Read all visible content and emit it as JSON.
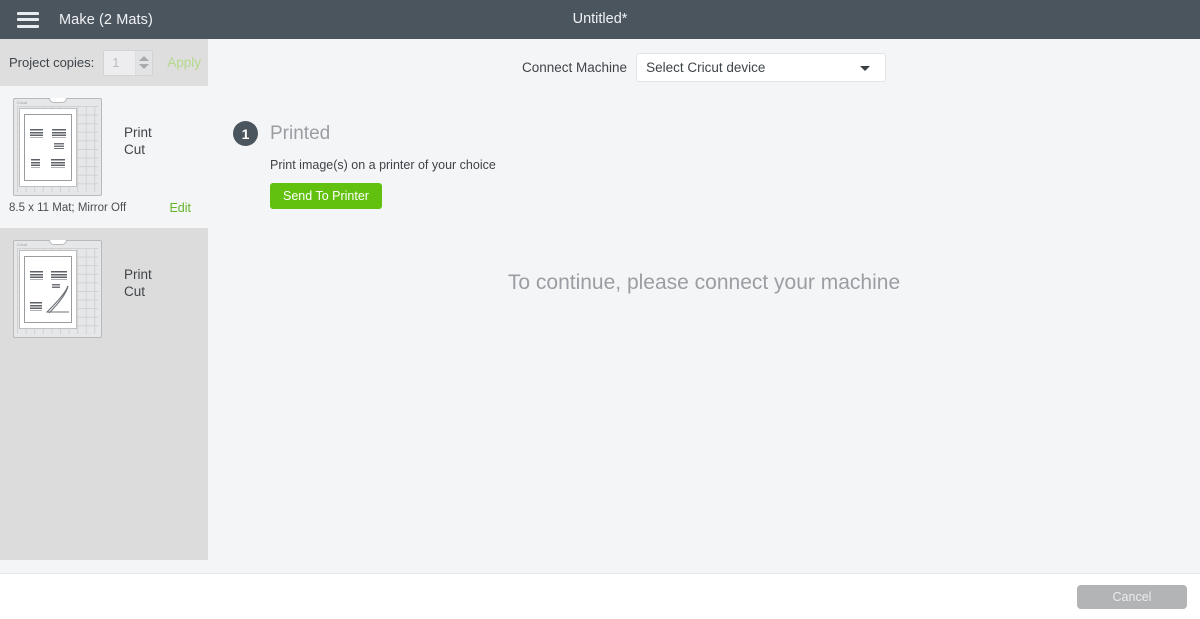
{
  "header": {
    "menu_icon": "hamburger-icon",
    "make_title": "Make (2 Mats)",
    "document_title": "Untitled*"
  },
  "sidebar": {
    "copies": {
      "label": "Project copies:",
      "value": "1",
      "apply_label": "Apply"
    },
    "mats": [
      {
        "selected": true,
        "actions": [
          "Print",
          "Cut"
        ],
        "caption": "8.5 x 11 Mat; Mirror Off",
        "edit_label": "Edit",
        "mat_brand": "Cricut"
      },
      {
        "selected": false,
        "actions": [
          "Print",
          "Cut"
        ],
        "caption": "",
        "edit_label": "",
        "mat_brand": "Cricut"
      }
    ]
  },
  "main": {
    "connect": {
      "label": "Connect Machine",
      "select_value": "Select Cricut device",
      "caret_icon": "chevron-down-icon"
    },
    "step": {
      "number": "1",
      "title": "Printed",
      "description": "Print image(s) on a printer of your choice",
      "button_label": "Send To Printer"
    },
    "connect_message": "To continue, please connect your machine"
  },
  "footer": {
    "cancel_label": "Cancel"
  },
  "colors": {
    "header_bg": "#4b555e",
    "accent_green": "#62c10e",
    "link_green": "#62b426",
    "panel_bg": "#f4f5f7",
    "panel_alt_bg": "#dcdcdc",
    "muted_text": "#9a9ea2"
  }
}
